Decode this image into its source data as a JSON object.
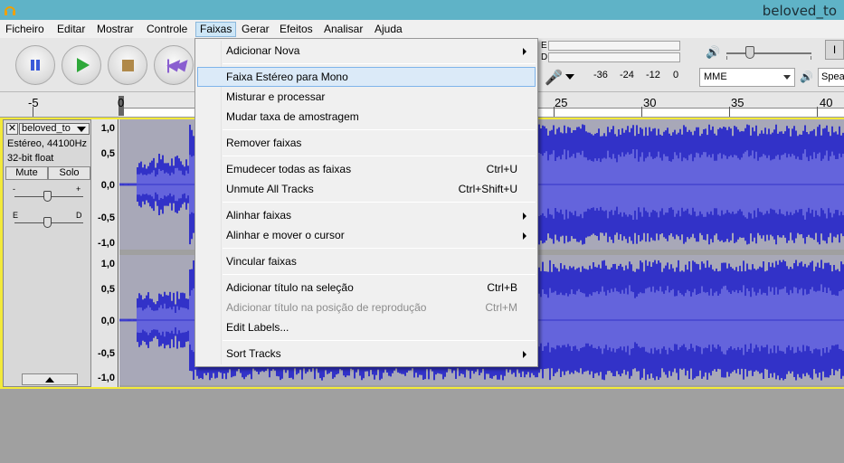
{
  "window": {
    "title": "beloved_to"
  },
  "menubar": {
    "items": [
      {
        "label": "Ficheiro",
        "active": false
      },
      {
        "label": "Editar",
        "active": false
      },
      {
        "label": "Mostrar",
        "active": false
      },
      {
        "label": "Controle",
        "active": false
      },
      {
        "label": "Faixas",
        "active": true
      },
      {
        "label": "Gerar",
        "active": false
      },
      {
        "label": "Efeitos",
        "active": false
      },
      {
        "label": "Analisar",
        "active": false
      },
      {
        "label": "Ajuda",
        "active": false
      }
    ]
  },
  "toolbar": {
    "meter_letters": [
      "E",
      "D"
    ],
    "db_labels": [
      "-36",
      "-24",
      "-12",
      "0"
    ],
    "host": "MME",
    "output": "Speak",
    "right_tool_icon": "I"
  },
  "ruler": {
    "labels": [
      "-5",
      "0",
      "25",
      "30",
      "35",
      "40"
    ]
  },
  "track": {
    "name": "beloved_to",
    "format": "Estéreo, 44100Hz",
    "bit_depth": "32-bit float",
    "mute": "Mute",
    "solo": "Solo",
    "gain_minus": "-",
    "gain_plus": "+",
    "pan_left": "E",
    "pan_right": "D",
    "scale_labels": [
      "1,0",
      "0,5",
      "0,0",
      "-0,5",
      "-1,0"
    ]
  },
  "faixas_menu": {
    "items": [
      {
        "label": "Adicionar Nova",
        "shortcut": "",
        "submenu": true,
        "disabled": false,
        "selected": false
      },
      {
        "label": "Faixa Estéreo para Mono",
        "shortcut": "",
        "submenu": false,
        "disabled": false,
        "selected": true
      },
      {
        "label": "Misturar e processar",
        "shortcut": "",
        "submenu": false,
        "disabled": false,
        "selected": false
      },
      {
        "label": "Mudar taxa de amostragem",
        "shortcut": "",
        "submenu": false,
        "disabled": false,
        "selected": false
      },
      {
        "label": "Remover faixas",
        "shortcut": "",
        "submenu": false,
        "disabled": false,
        "selected": false
      },
      {
        "label": "Emudecer todas as faixas",
        "shortcut": "Ctrl+U",
        "submenu": false,
        "disabled": false,
        "selected": false
      },
      {
        "label": "Unmute All Tracks",
        "shortcut": "Ctrl+Shift+U",
        "submenu": false,
        "disabled": false,
        "selected": false
      },
      {
        "label": "Alinhar faixas",
        "shortcut": "",
        "submenu": true,
        "disabled": false,
        "selected": false
      },
      {
        "label": "Alinhar e mover o cursor",
        "shortcut": "",
        "submenu": true,
        "disabled": false,
        "selected": false
      },
      {
        "label": "Vincular faixas",
        "shortcut": "",
        "submenu": false,
        "disabled": false,
        "selected": false
      },
      {
        "label": "Adicionar título na seleção",
        "shortcut": "Ctrl+B",
        "submenu": false,
        "disabled": false,
        "selected": false
      },
      {
        "label": "Adicionar título na posição de reprodução",
        "shortcut": "Ctrl+M",
        "submenu": false,
        "disabled": true,
        "selected": false
      },
      {
        "label": "Edit Labels...",
        "shortcut": "",
        "submenu": false,
        "disabled": false,
        "selected": false
      },
      {
        "label": "Sort Tracks",
        "shortcut": "",
        "submenu": true,
        "disabled": false,
        "selected": false
      }
    ]
  },
  "colors": {
    "titlebar": "#5fb3c7",
    "waveform": "#3232c8",
    "waveform_rms": "#6464dc",
    "track_focus": "#f3ea3a",
    "menu_highlight": "#dbeaf8"
  }
}
